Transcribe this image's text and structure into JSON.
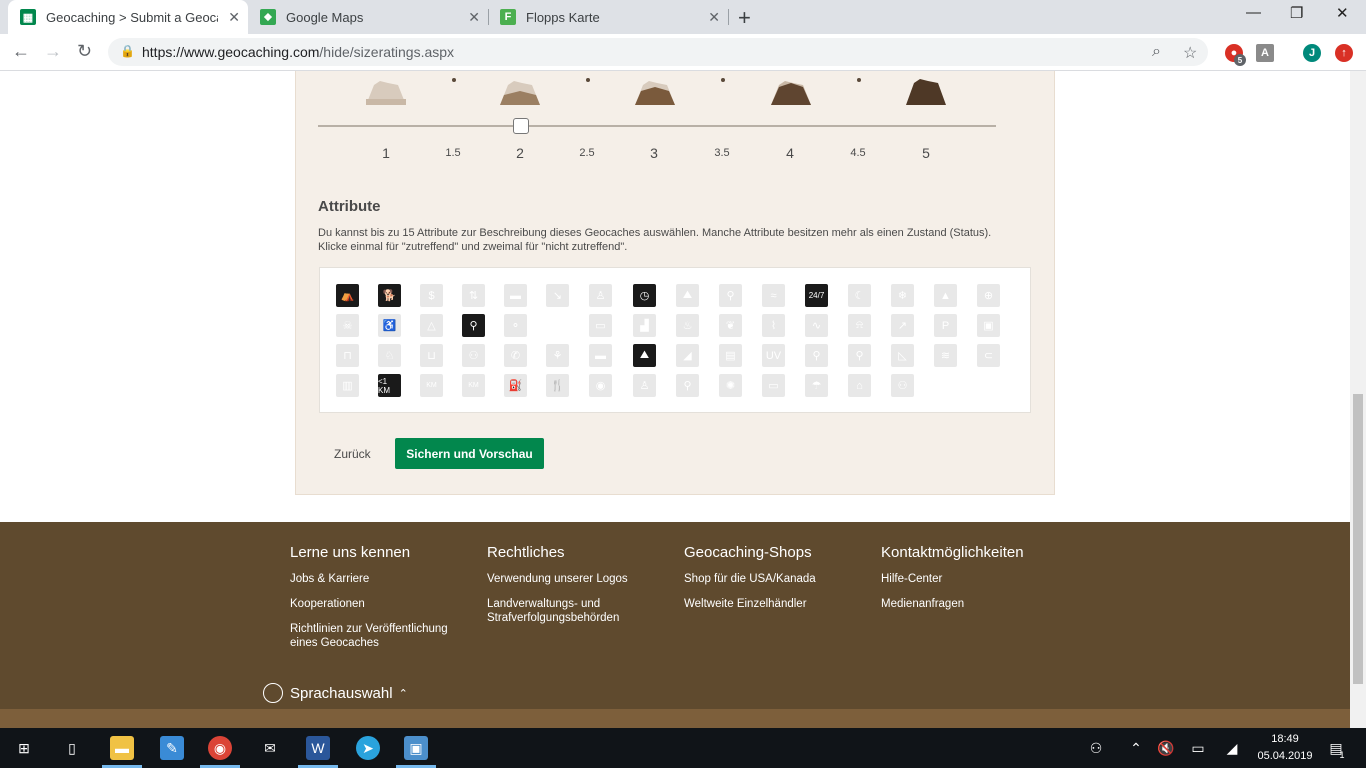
{
  "browser": {
    "tabs": [
      {
        "title": "Geocaching > Submit a Geocache",
        "icon": "geocaching-icon",
        "active": true
      },
      {
        "title": "Google Maps",
        "icon": "google-maps-icon",
        "active": false
      },
      {
        "title": "Flopps Karte",
        "icon": "flopps-icon",
        "active": false
      }
    ],
    "url_host": "https://www.geocaching.com",
    "url_path": "/hide/sizeratings.aspx",
    "extension_badge": "5",
    "profile_initial": "J"
  },
  "rating": {
    "value": 2,
    "ticks_major": [
      "1",
      "2",
      "3",
      "4",
      "5"
    ],
    "ticks_minor": [
      "1.5",
      "2.5",
      "3.5",
      "4.5"
    ]
  },
  "attributes": {
    "title": "Attribute",
    "description": "Du kannst bis zu 15 Attribute zur Beschreibung dieses Geocaches auswählen. Manche Attribute besitzen mehr als einen Zustand (Status). Klicke einmal für \"zutreffend\" und zweimal für \"nicht zutreffend\".",
    "labels": {
      "twentyfour": "24/7",
      "uv": "UV",
      "p": "P",
      "km1": "<1 KM"
    }
  },
  "actions": {
    "back": "Zurück",
    "save": "Sichern und Vorschau"
  },
  "footer": {
    "columns": [
      {
        "heading": "Lerne uns kennen",
        "links": [
          "Jobs & Karriere",
          "Kooperationen",
          "Richtlinien zur Veröffentlichung eines Geocaches"
        ]
      },
      {
        "heading": "Rechtliches",
        "links": [
          "Verwendung unserer Logos",
          "Landverwaltungs- und Strafverfolgungsbehörden"
        ]
      },
      {
        "heading": "Geocaching-Shops",
        "links": [
          "Shop für die USA/Kanada",
          "Weltweite Einzelhändler"
        ]
      },
      {
        "heading": "Kontaktmöglichkeiten",
        "links": [
          "Hilfe-Center",
          "Medienanfragen"
        ]
      }
    ],
    "language": "Sprachauswahl"
  },
  "taskbar": {
    "time": "18:49",
    "date": "05.04.2019",
    "notification_count": "1"
  },
  "colors": {
    "accent_green": "#02874d",
    "footer_brown": "#5f4a2e",
    "panel_beige": "#f5efe8"
  }
}
